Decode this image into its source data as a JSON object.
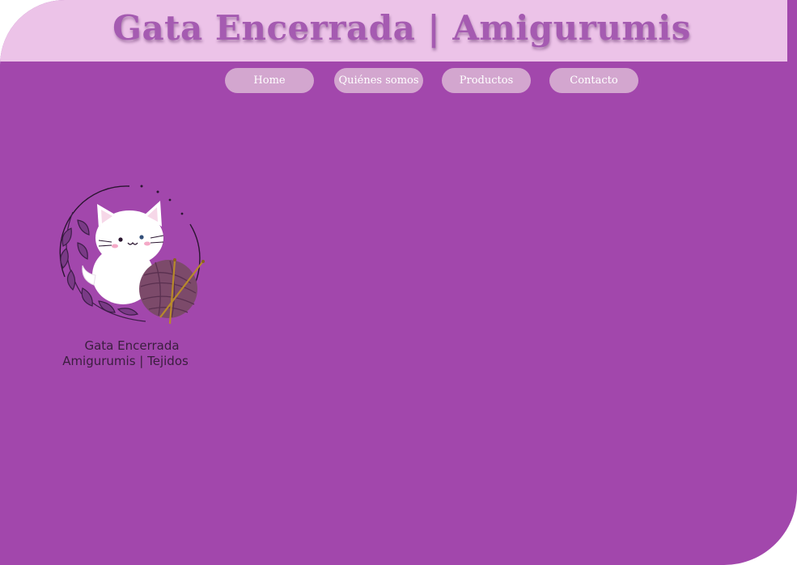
{
  "header": {
    "title": "Gata Encerrada | Amigurumis"
  },
  "nav": {
    "items": [
      {
        "label": "Home"
      },
      {
        "label": "Quiénes somos"
      },
      {
        "label": "Productos"
      },
      {
        "label": "Contacto"
      }
    ]
  },
  "logo": {
    "line1": "Gata Encerrada",
    "line2": "Amigurumis | Tejidos"
  },
  "colors": {
    "background": "#a247ac",
    "header_band": "#ecc3e8",
    "title_text": "#a55bb1",
    "nav_button": "#d3a6cf",
    "nav_text": "#ffffff"
  }
}
